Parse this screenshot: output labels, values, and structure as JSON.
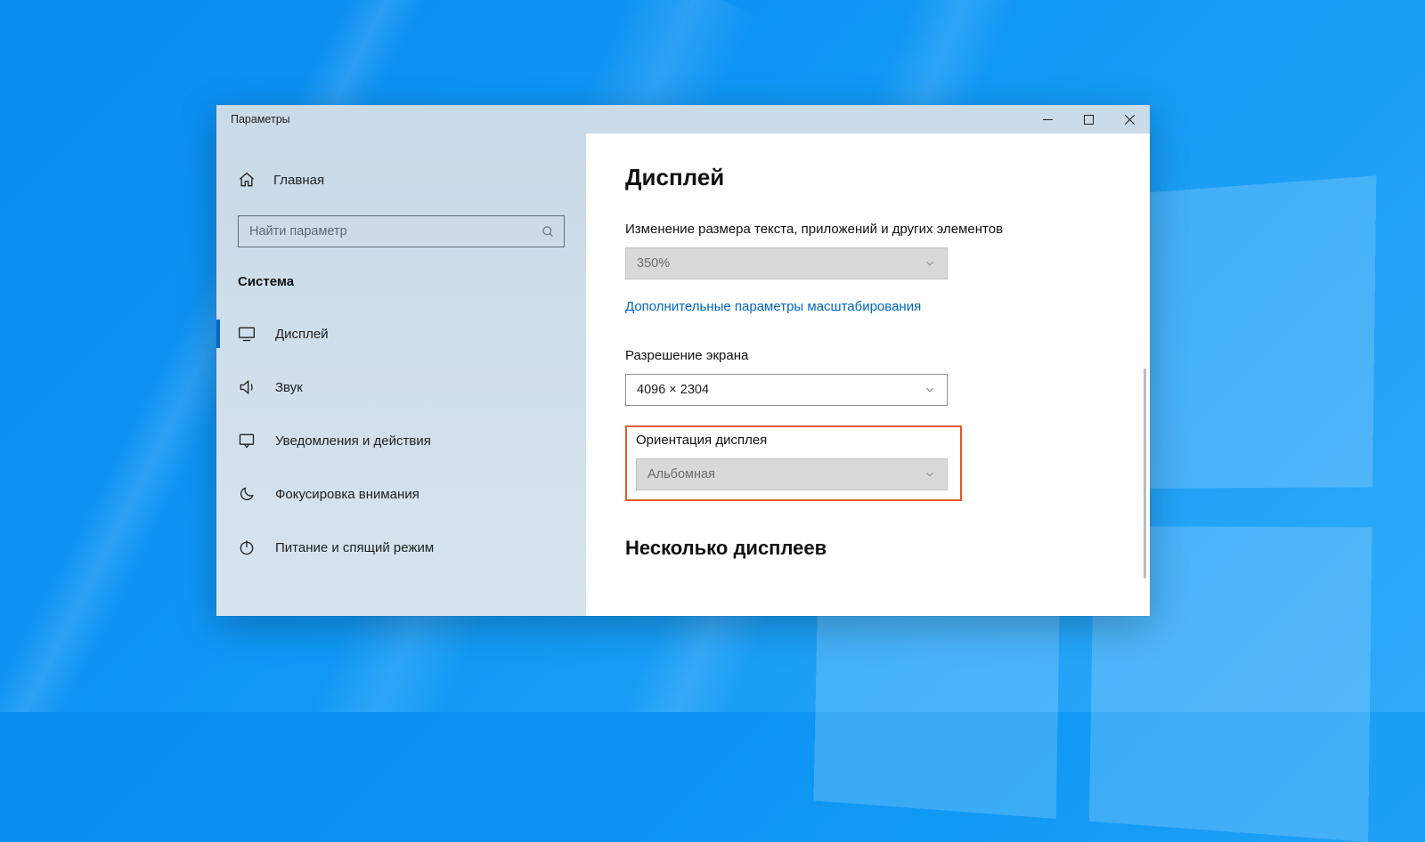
{
  "window": {
    "title": "Параметры"
  },
  "sidebar": {
    "home": "Главная",
    "search_placeholder": "Найти параметр",
    "category": "Система",
    "items": [
      {
        "label": "Дисплей",
        "icon": "monitor-icon",
        "active": true
      },
      {
        "label": "Звук",
        "icon": "sound-icon"
      },
      {
        "label": "Уведомления и действия",
        "icon": "notification-icon"
      },
      {
        "label": "Фокусировка внимания",
        "icon": "moon-icon"
      },
      {
        "label": "Питание и спящий режим",
        "icon": "power-icon"
      }
    ]
  },
  "page": {
    "title": "Дисплей",
    "scale_label": "Изменение размера текста, приложений и других элементов",
    "scale_value": "350%",
    "advanced_scaling_link": "Дополнительные параметры масштабирования",
    "resolution_label": "Разрешение экрана",
    "resolution_value": "4096 × 2304",
    "orientation_label": "Ориентация дисплея",
    "orientation_value": "Альбомная",
    "multi_display_title": "Несколько дисплеев"
  }
}
